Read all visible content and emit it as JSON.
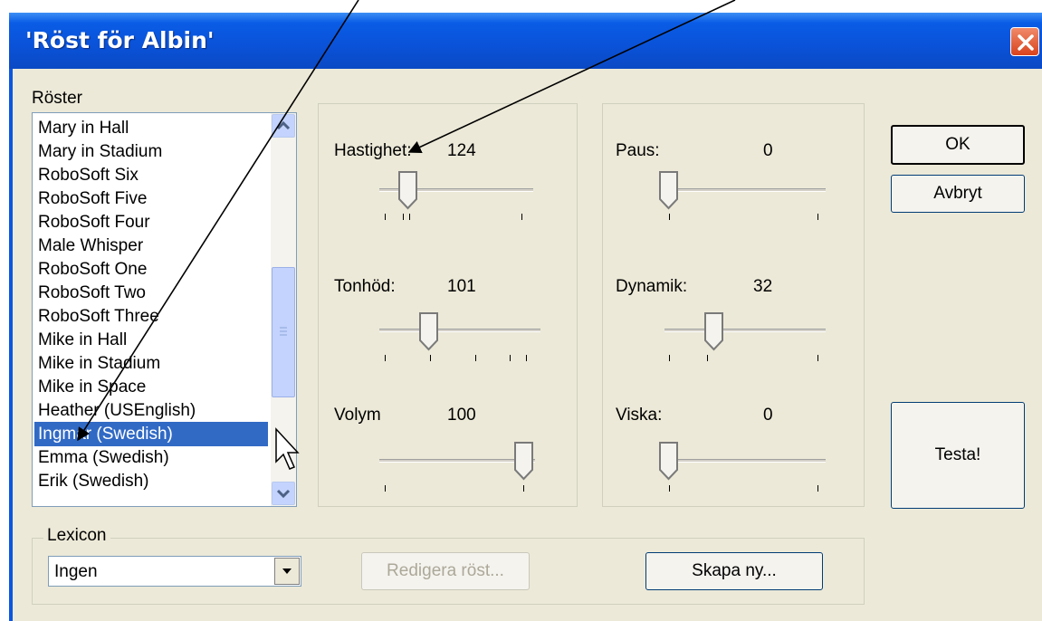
{
  "window": {
    "title": "'Röst för Albin'"
  },
  "voices": {
    "label": "Röster",
    "items": [
      "Mary in Hall",
      "Mary in Stadium",
      "RoboSoft Six",
      "RoboSoft Five",
      "RoboSoft Four",
      "Male Whisper",
      "RoboSoft One",
      "RoboSoft Two",
      "RoboSoft Three",
      "Mike in Hall",
      "Mike in Stadium",
      "Mike in Space",
      "Heather (USEnglish)",
      "Ingmar (Swedish)",
      "Emma (Swedish)",
      "Erik (Swedish)"
    ],
    "selected": "Ingmar (Swedish)"
  },
  "sliders": {
    "hastighet": {
      "label": "Hastighet:",
      "value": "124"
    },
    "tonhojd": {
      "label": "Tonhöd:",
      "value": "101"
    },
    "volym": {
      "label": "Volym",
      "value": "100"
    },
    "paus": {
      "label": "Paus:",
      "value": "0"
    },
    "dynamik": {
      "label": "Dynamik:",
      "value": "32"
    },
    "viska": {
      "label": "Viska:",
      "value": "0"
    }
  },
  "buttons": {
    "ok": "OK",
    "cancel": "Avbryt",
    "test": "Testa!",
    "edit_voice": "Redigera röst...",
    "create_new": "Skapa ny..."
  },
  "lexicon": {
    "label": "Lexicon",
    "value": "Ingen"
  },
  "colors": {
    "title_bar": "#0a56e0",
    "selection": "#316ac5",
    "dialog_bg": "#ece9d8",
    "close": "#d9421c"
  },
  "icons": [
    "close-icon",
    "scroll-up-icon",
    "scroll-down-icon",
    "dropdown-arrow-icon",
    "mouse-cursor-icon",
    "annotation-arrow-icon"
  ]
}
